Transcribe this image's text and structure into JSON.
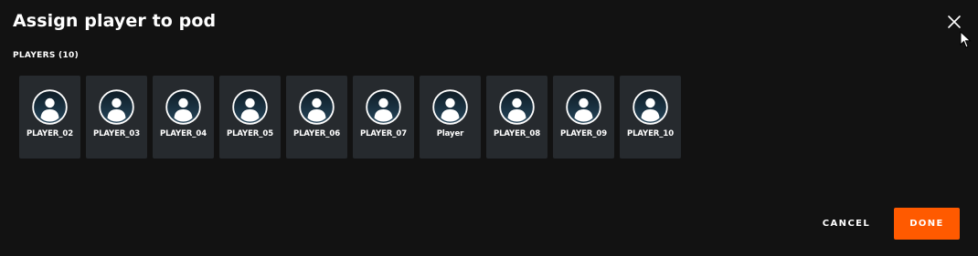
{
  "dialog": {
    "title": "Assign player to pod",
    "close_icon": "close-icon"
  },
  "players_section": {
    "label": "PLAYERS (10)",
    "players": [
      {
        "name": "PLAYER_02",
        "icon": "user-avatar-icon"
      },
      {
        "name": "PLAYER_03",
        "icon": "user-avatar-icon"
      },
      {
        "name": "PLAYER_04",
        "icon": "user-avatar-icon"
      },
      {
        "name": "PLAYER_05",
        "icon": "user-avatar-icon"
      },
      {
        "name": "PLAYER_06",
        "icon": "user-avatar-icon"
      },
      {
        "name": "PLAYER_07",
        "icon": "user-avatar-icon"
      },
      {
        "name": "Player",
        "icon": "user-avatar-icon"
      },
      {
        "name": "PLAYER_08",
        "icon": "user-avatar-icon"
      },
      {
        "name": "PLAYER_09",
        "icon": "user-avatar-icon"
      },
      {
        "name": "PLAYER_10",
        "icon": "user-avatar-icon"
      }
    ]
  },
  "actions": {
    "cancel_label": "CANCEL",
    "done_label": "DONE"
  },
  "colors": {
    "background": "#121212",
    "card": "#262a2e",
    "accent": "#ff5a00",
    "text": "#ffffff"
  }
}
